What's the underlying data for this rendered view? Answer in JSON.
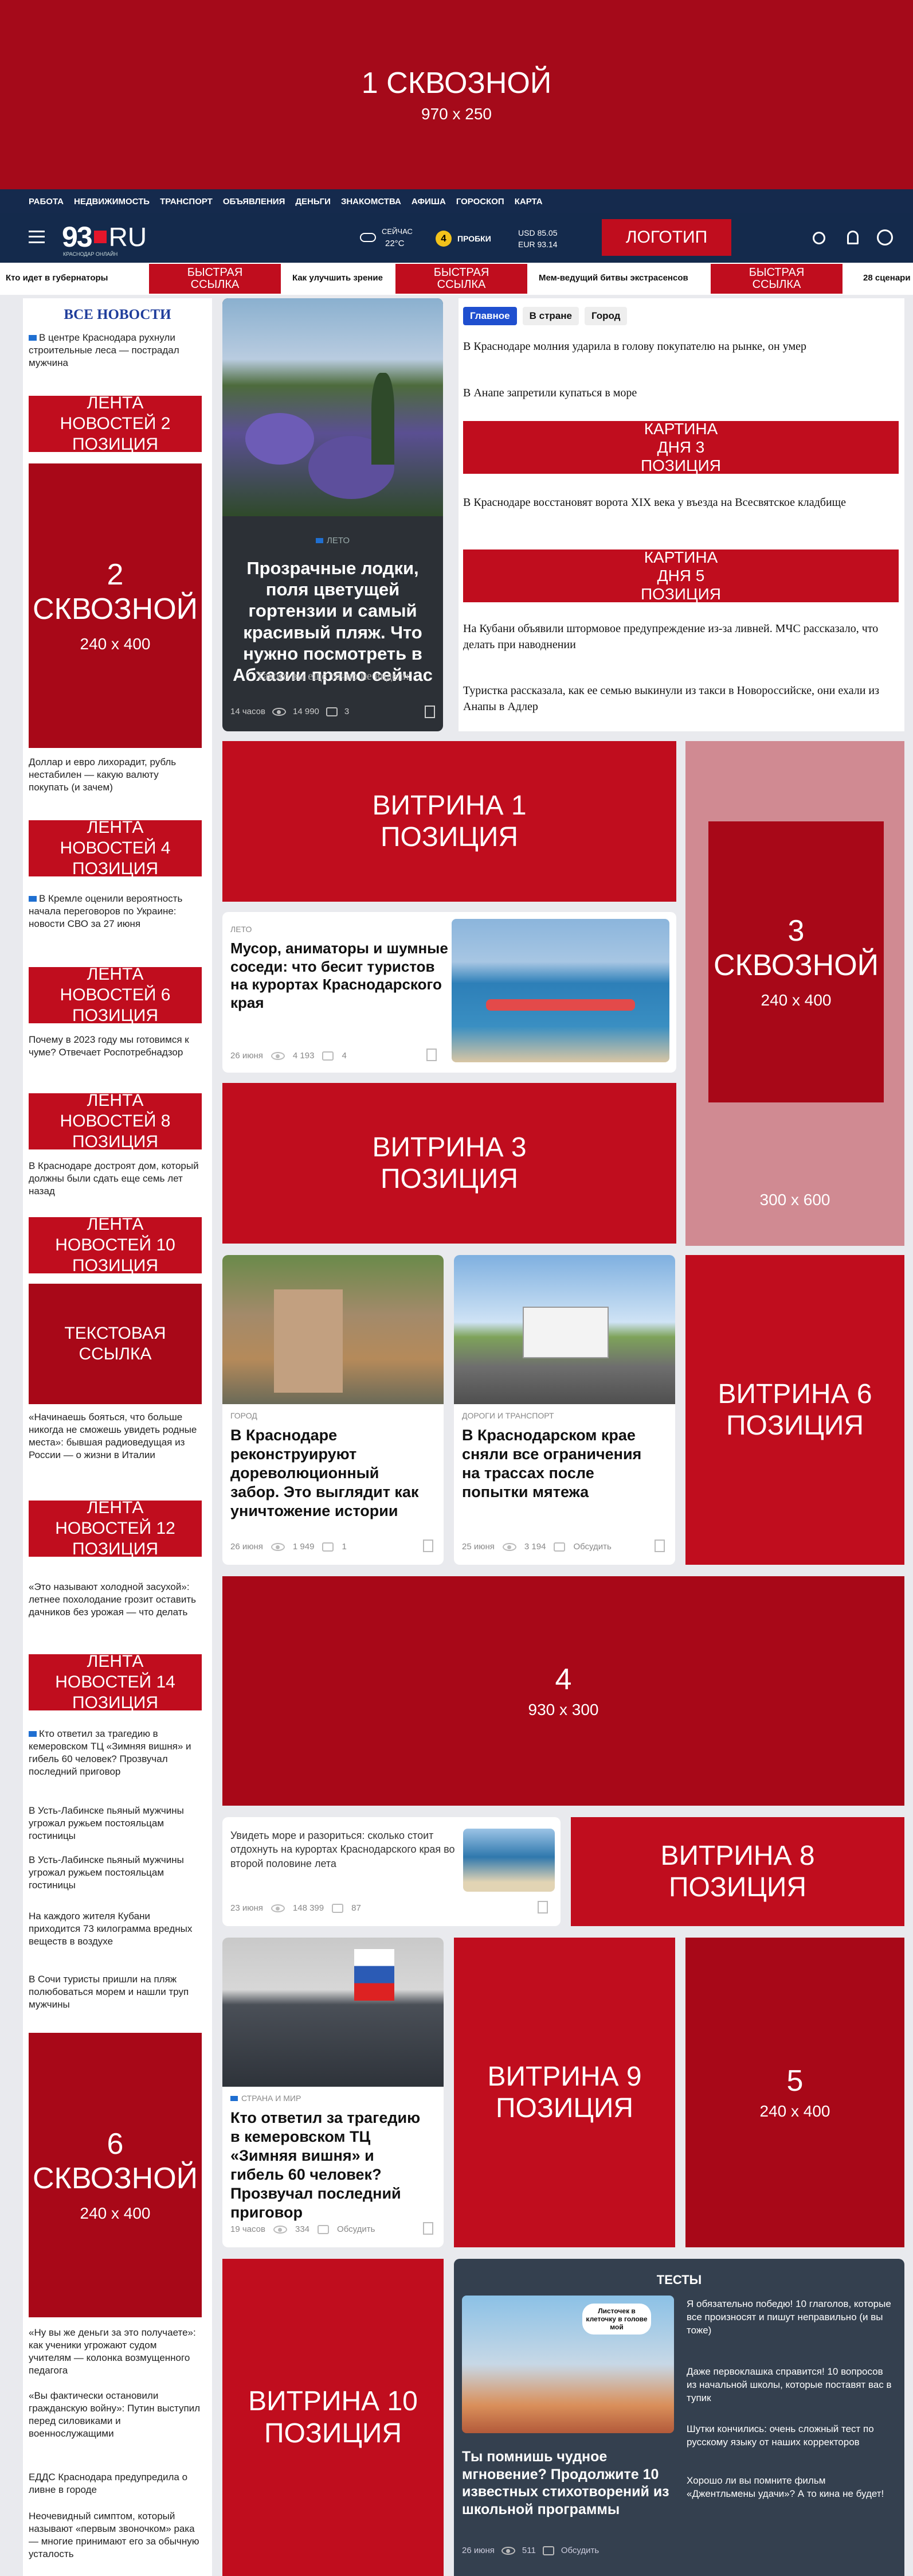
{
  "top_banner": {
    "label": "1 СКВОЗНОЙ",
    "size": "970 x 250"
  },
  "nav": {
    "links": [
      "РАБОТА",
      "НЕДВИЖИМОСТЬ",
      "ТРАНСПОРТ",
      "ОБЪЯВЛЕНИЯ",
      "ДЕНЬГИ",
      "ЗНАКОМСТВА",
      "АФИША",
      "ГОРОСКОП",
      "КАРТА"
    ]
  },
  "header": {
    "logo": "93",
    "logo_suffix": "RU",
    "logo_sub": "КРАСНОДАР ОНЛАЙН",
    "weather_label": "СЕЙЧАС",
    "weather_temp": "22°C",
    "traffic_score": "4",
    "traffic_label": "ПРОБКИ",
    "usd": "USD 85.05",
    "eur": "EUR 93.14",
    "logo_button": "ЛОГОТИП"
  },
  "quick": {
    "items": [
      "Кто идет в губернаторы",
      "БЫСТРАЯ ССЫЛКА",
      "Как улучшить зрение",
      "БЫСТРАЯ ССЫЛКА",
      "Мем-ведущий битвы экстрасенсов",
      "БЫСТРАЯ ССЫЛКА",
      "28 сценари"
    ]
  },
  "sidebar": {
    "title": "ВСЕ НОВОСТИ",
    "n1": "В центре Краснодара рухнули строительные леса — пострадал мужчина",
    "l2": "ЛЕНТА НОВОСТЕЙ 2 ПОЗИЦИЯ",
    "ad2_num": "2",
    "ad2_label": "СКВОЗНОЙ",
    "ad2_size": "240 x 400",
    "n2": "Доллар и евро лихорадит, рубль нестабилен — какую валюту покупать (и зачем)",
    "l4": "ЛЕНТА НОВОСТЕЙ 4 ПОЗИЦИЯ",
    "n3": "В Кремле оценили вероятность начала переговоров по Украине: новости СВО за 27 июня",
    "l6": "ЛЕНТА НОВОСТЕЙ 6 ПОЗИЦИЯ",
    "n4": "Почему в 2023 году мы готовимся к чуме? Отвечает Роспотребнадзор",
    "l8": "ЛЕНТА НОВОСТЕЙ 8 ПОЗИЦИЯ",
    "n5": "В Краснодаре достроят дом, который должны были сдать еще семь лет назад",
    "l10": "ЛЕНТА НОВОСТЕЙ 10 ПОЗИЦИЯ",
    "text_link": "ТЕКСТОВАЯ ССЫЛКА",
    "n6": "«Начинаешь бояться, что больше никогда не сможешь увидеть родные места»: бывшая радиоведущая из России — о жизни в Италии",
    "l12": "ЛЕНТА НОВОСТЕЙ 12 ПОЗИЦИЯ",
    "n7": "«Это называют холодной засухой»: летнее похолодание грозит оставить дачников без урожая — что делать",
    "l14": "ЛЕНТА НОВОСТЕЙ 14 ПОЗИЦИЯ",
    "n8": "Кто ответил за трагедию в кемеровском ТЦ «Зимняя вишня» и гибель 60 человек? Прозвучал последний приговор",
    "n9": "В Усть-Лабинске пьяный мужчины угрожал ружьем постояльцам гостиницы",
    "n10": "В Усть-Лабинске пьяный мужчины угрожал ружьем постояльцам гостиницы",
    "n11": "На каждого жителя Кубани приходится 73 килограмма вредных веществ в воздухе",
    "n12": "В Сочи туристы пришли на пляж полюбоваться морем и нашли труп мужчины",
    "ad6_num": "6",
    "ad6_label": "СКВОЗНОЙ",
    "ad6_size": "240 x 400",
    "n13": "«Ну вы же деньги за это получаете»: как ученики угрожают судом учителям — колонка возмущенного педагога",
    "n14": "«Вы фактически остановили гражданскую войну»: Путин выступил перед силовиками и военнослужащими",
    "n15": "ЕДДС Краснодара предупредила о ливне в городе",
    "n16": "Неочевидный симптом, который называют «первым звоночком» рака — многие принимают его за обычную усталость"
  },
  "feature": {
    "tag": "ЛЕТО",
    "title": "Прозрачные лодки, поля цветущей гортензии и самый красивый пляж. Что нужно посмотреть в Абхазии прямо сейчас",
    "sub": "Такого вы еще точно не видели",
    "time": "14 часов",
    "views": "14 990",
    "comments": "3"
  },
  "top_tabs": [
    "Главное",
    "В стране",
    "Город"
  ],
  "top_news": {
    "t1": "В Краснодаре молния ударила в голову покупателю на рынке, он умер",
    "t2": "В Анапе запретили купаться в море",
    "kd3": "КАРТИНА ДНЯ 3 ПОЗИЦИЯ",
    "t3": "В Краснодаре восстановят ворота XIX века у въезда на Всесвятское кладбище",
    "kd5": "КАРТИНА ДНЯ 5 ПОЗИЦИЯ",
    "t4": "На Кубани объявили штормовое предупреждение из-за ливней. МЧС рассказало, что делать при наводнении",
    "t5": "Туристка рассказала, как ее семью выкинули из такси в Новороссийске, они ехали из Анапы в Адлер"
  },
  "vitrina": {
    "v1": "ВИТРИНА 1 ПОЗИЦИЯ",
    "v3": "ВИТРИНА 3 ПОЗИЦИЯ",
    "v6": "ВИТРИНА 6 ПОЗИЦИЯ",
    "v8": "ВИТРИНА 8 ПОЗИЦИЯ",
    "v9": "ВИТРИНА 9 ПОЗИЦИЯ",
    "v10": "ВИТРИНА 10 ПОЗИЦИЯ"
  },
  "ad3": {
    "num": "3",
    "label": "СКВОЗНОЙ",
    "size": "240 x 400",
    "outer": "300 x 600"
  },
  "ad4": {
    "num": "4",
    "size": "930 x 300"
  },
  "ad5": {
    "num": "5",
    "size": "240 x 400"
  },
  "card_beach": {
    "tag": "ЛЕТО",
    "title": "Мусор, аниматоры и шумные соседи: что бесит туристов на курортах Краснодарского края",
    "time": "26 июня",
    "views": "4 193",
    "comments": "4"
  },
  "card_fence": {
    "tag": "ГОРОД",
    "title": "В Краснодаре реконструируют дореволюционный забор. Это выглядит как уничтожение истории",
    "time": "26 июня",
    "views": "1 949",
    "comments": "1"
  },
  "card_truck": {
    "tag": "ДОРОГИ И ТРАНСПОРТ",
    "title": "В Краснодарском крае сняли все ограничения на трассах после попытки мятежа",
    "time": "25 июня",
    "views": "3 194",
    "comments": "Обсудить"
  },
  "card_sea": {
    "title": "Увидеть море и разориться: сколько стоит отдохнуть на курортах Краснодарского края во второй половине лета",
    "time": "23 июня",
    "views": "148 399",
    "comments": "87"
  },
  "card_court": {
    "tag": "СТРАНА И МИР",
    "title": "Кто ответил за трагедию в кемеровском ТЦ «Зимняя вишня» и гибель 60 человек? Прозвучал последний приговор",
    "time": "19 часов",
    "views": "334",
    "comments": "Обсудить"
  },
  "tests": {
    "title": "ТЕСТЫ",
    "main_title": "Ты помнишь чудное мгновение? Продолжите 10 известных стихотворений из школьной программы",
    "time": "26 июня",
    "views": "511",
    "comments": "Обсудить",
    "bubble": "Листочек в клеточку в голове мой",
    "items": [
      "Я обязательно победю! 10 глаголов, которые все произносят и пишут неправильно (и вы тоже)",
      "Даже первоклашка справится! 10 вопросов из начальной школы, которые поставят вас в тупик",
      "Шутки кончились: очень сложный тест по русскому языку от наших корректоров",
      "Хорошо ли вы помните фильм «Джентльмены удачи»? А то кина не будет!"
    ]
  }
}
